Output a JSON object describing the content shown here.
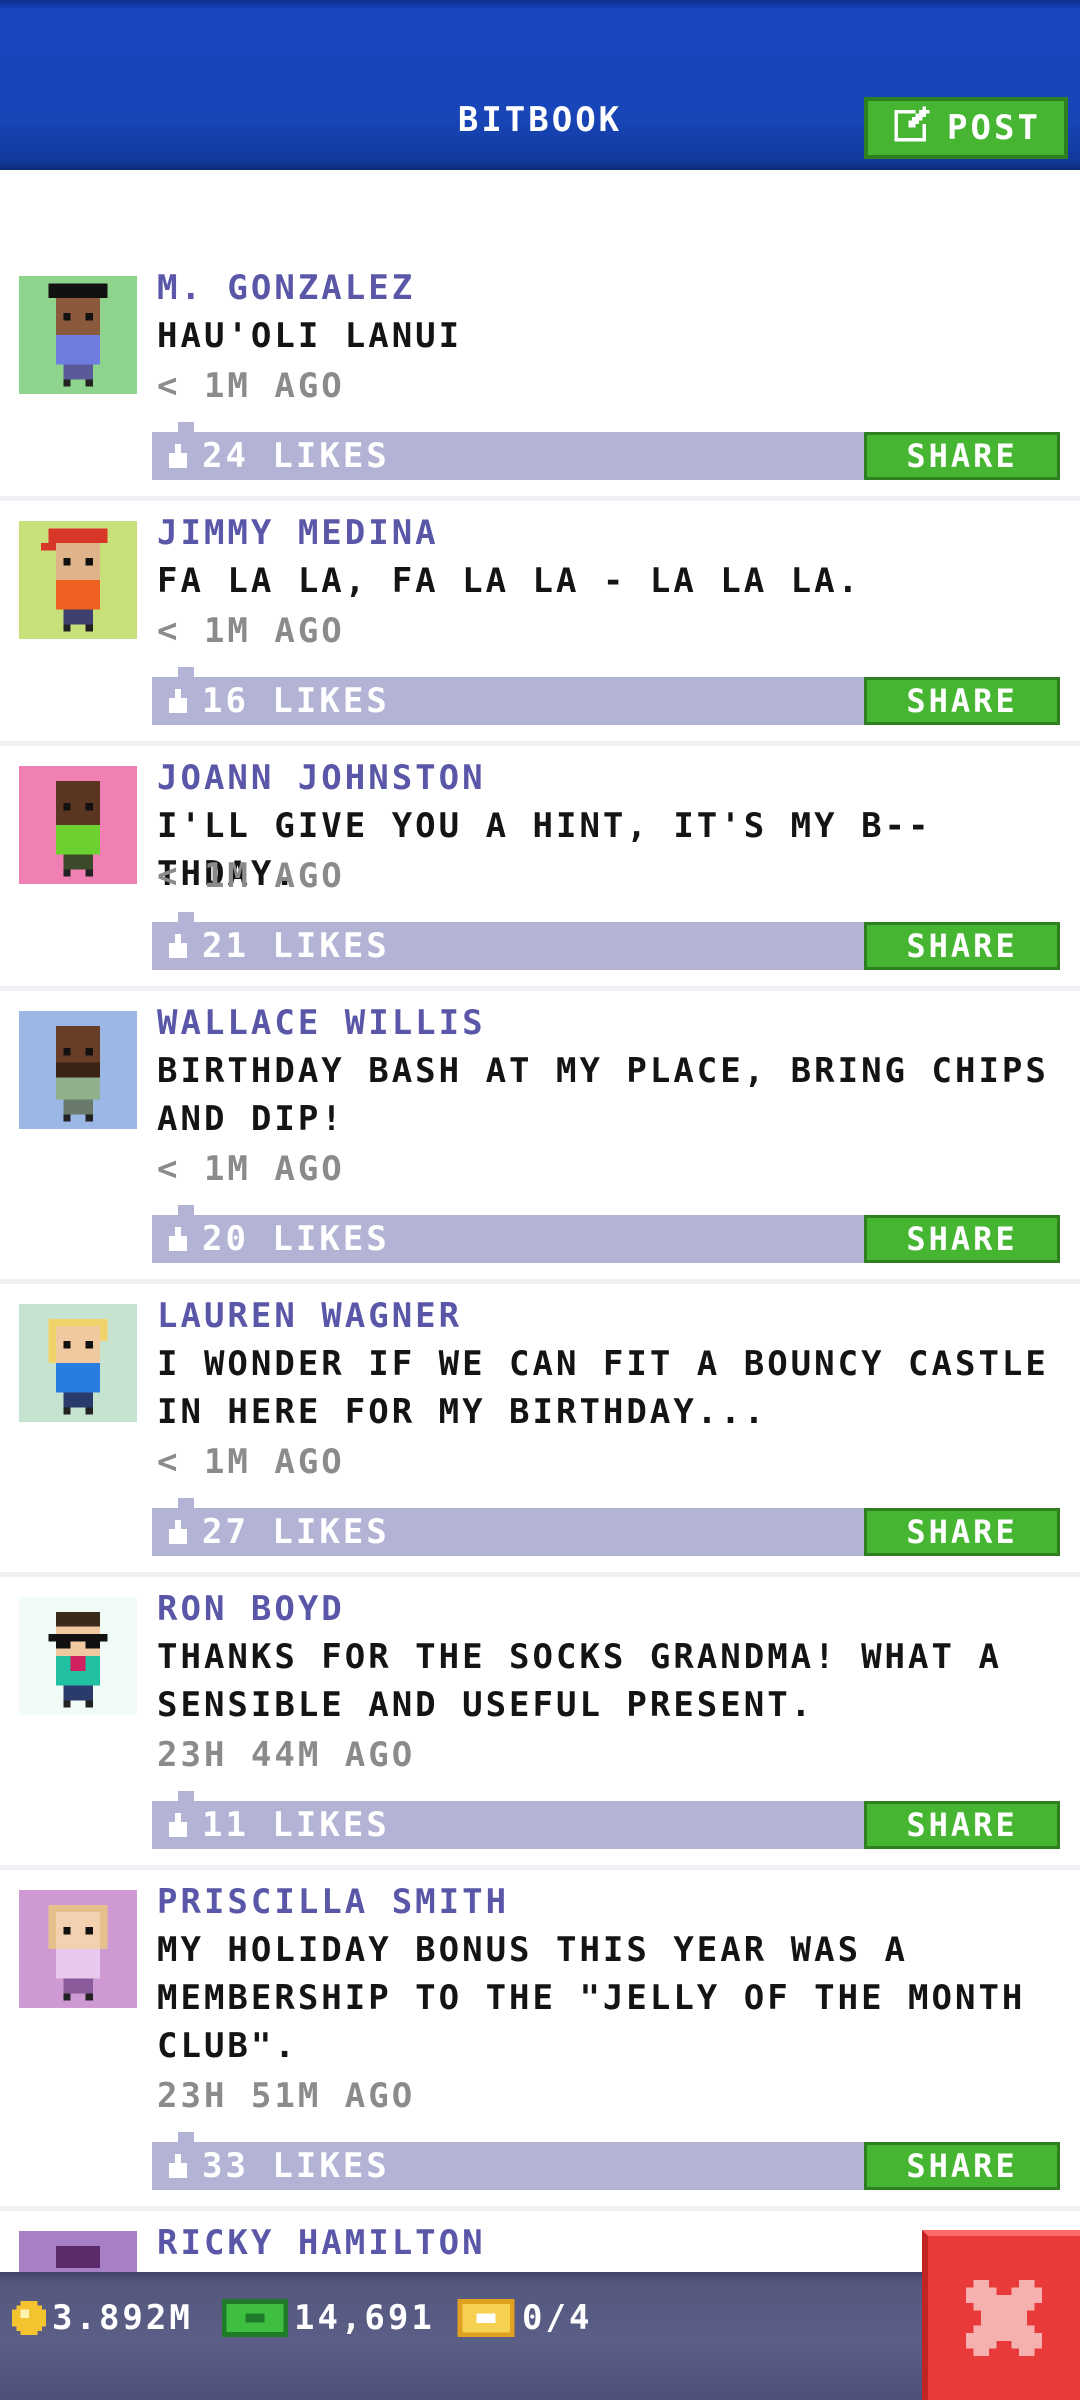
{
  "header": {
    "title": "BITBOOK",
    "post_label": "POST"
  },
  "posts": [
    {
      "name": "M. GONZALEZ",
      "message": "HAU'OLI LANUI",
      "time": "< 1M AGO",
      "likes": "24 LIKES",
      "share": "SHARE",
      "avatar_bg": "#8fd48c"
    },
    {
      "name": "JIMMY MEDINA",
      "message": "FA LA LA, FA LA LA - LA LA LA.",
      "time": "< 1M AGO",
      "likes": "16 LIKES",
      "share": "SHARE",
      "avatar_bg": "#c8e07a"
    },
    {
      "name": "JOANN JOHNSTON",
      "message": "I'LL GIVE YOU A HINT, IT'S MY B--THDAY.",
      "time": "< 1M AGO",
      "likes": "21 LIKES",
      "share": "SHARE",
      "avatar_bg": "#f07fb4"
    },
    {
      "name": "WALLACE WILLIS",
      "message": "BIRTHDAY BASH AT MY PLACE, BRING CHIPS AND DIP!",
      "time": "< 1M AGO",
      "likes": "20 LIKES",
      "share": "SHARE",
      "avatar_bg": "#9ab7e6"
    },
    {
      "name": "LAUREN WAGNER",
      "message": "I WONDER IF WE CAN FIT A BOUNCY CASTLE IN HERE FOR MY BIRTHDAY...",
      "time": "< 1M AGO",
      "likes": "27 LIKES",
      "share": "SHARE",
      "avatar_bg": "#c5e3cf"
    },
    {
      "name": "RON BOYD",
      "message": "THANKS FOR THE SOCKS GRANDMA! WHAT A SENSIBLE AND USEFUL PRESENT.",
      "time": "23H 44M AGO",
      "likes": "11 LIKES",
      "share": "SHARE",
      "avatar_bg": "#f0fbf8"
    },
    {
      "name": "PRISCILLA SMITH",
      "message": "MY HOLIDAY BONUS THIS YEAR WAS A MEMBERSHIP TO THE \"JELLY OF THE MONTH CLUB\".",
      "time": "23H 51M AGO",
      "likes": "33 LIKES",
      "share": "SHARE",
      "avatar_bg": "#cf9ad3"
    },
    {
      "name": "RICKY HAMILTON",
      "avatar_bg": "#a77fc4"
    }
  ],
  "bottom_bar": {
    "coins": "3.892M",
    "bux": "14,691",
    "tickets": "0/4"
  },
  "colors": {
    "header": "#1845b6",
    "share_green": "#46b632",
    "like_bar": "#b3b3d6",
    "name_purple": "#5a57a8",
    "close_red": "#e93a3a",
    "bottom_bar": "#54577e"
  },
  "icons": {
    "post": "edit-icon",
    "like": "thumb-up-icon",
    "coins": "coin-icon",
    "bux": "bux-icon",
    "tickets": "ticket-icon",
    "close": "close-icon"
  }
}
